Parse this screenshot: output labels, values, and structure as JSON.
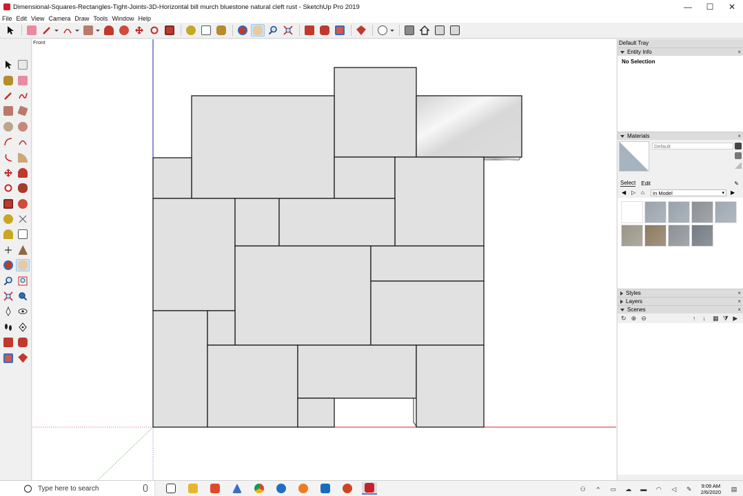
{
  "window": {
    "title": "Dimensional-Squares-Rectangles-Tight-Joints-3D-Horizontal bill murch bluestone natural cleft rust - SketchUp Pro 2019",
    "minimize_glyph": "—",
    "maximize_glyph": "☐",
    "close_glyph": "✕"
  },
  "menu": [
    "File",
    "Edit",
    "View",
    "Camera",
    "Draw",
    "Tools",
    "Window",
    "Help"
  ],
  "viewport": {
    "scene_label": "Front"
  },
  "tray": {
    "title": "Default Tray",
    "entity_info": {
      "heading": "Entity Info",
      "value": "No Selection"
    },
    "materials": {
      "heading": "Materials",
      "material_name": "Default",
      "tabs": [
        "Select",
        "Edit"
      ],
      "collection": "In Model",
      "thumb_colors": [
        "#ffffff",
        "#9aa3ad",
        "#98a2ab",
        "#8c9094",
        "#9ea7b1",
        "#9a9588",
        "#8d7a60",
        "#8d9095",
        "#747b83"
      ]
    },
    "styles": {
      "heading": "Styles"
    },
    "layers": {
      "heading": "Layers"
    },
    "scenes": {
      "heading": "Scenes"
    }
  },
  "taskbar": {
    "search_placeholder": "Type here to search",
    "time": "9:09 AM",
    "date": "2/6/2020"
  }
}
